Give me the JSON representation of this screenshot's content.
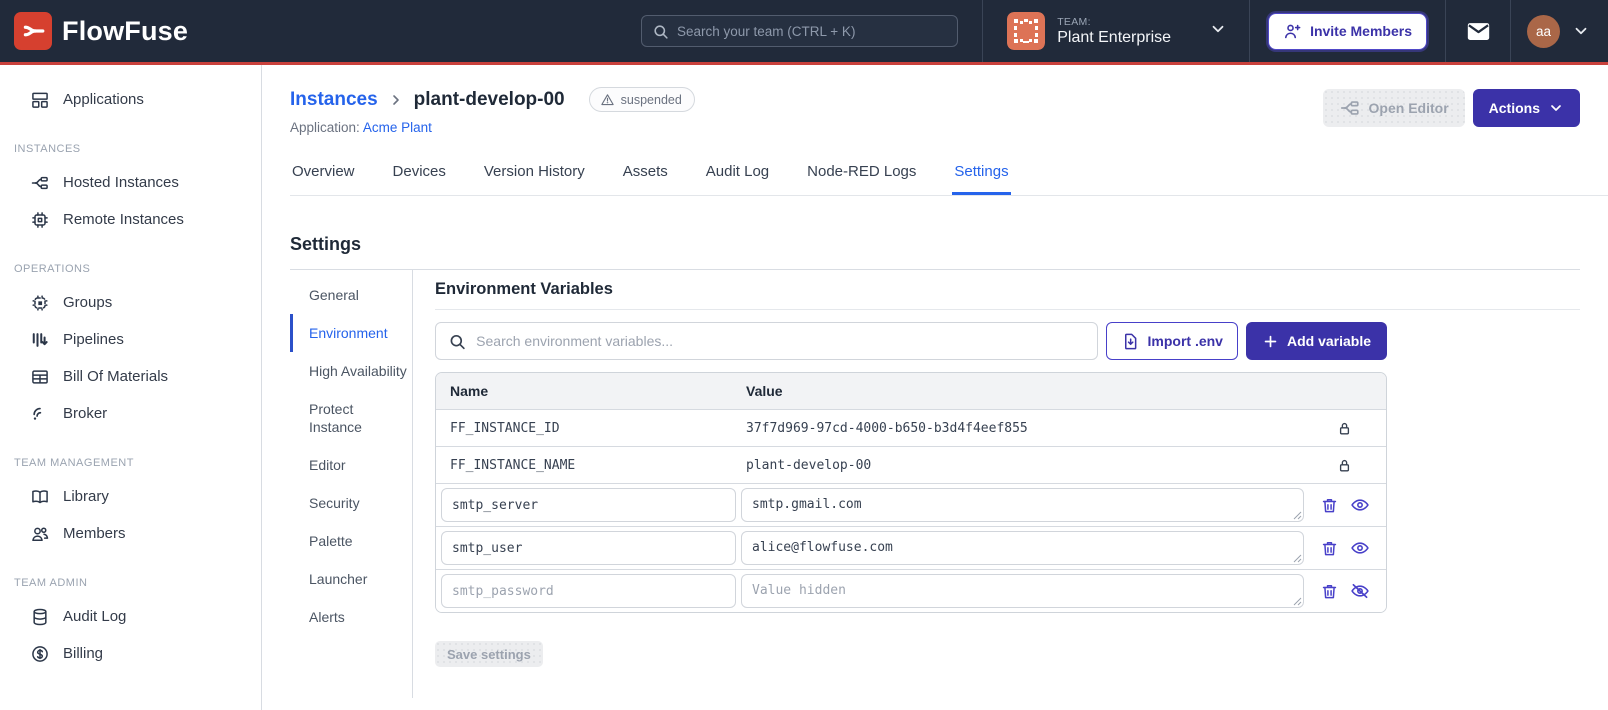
{
  "navbar": {
    "brand": "FlowFuse",
    "search": {
      "placeholder": "Search your team (CTRL + K)"
    },
    "team": {
      "label": "TEAM:",
      "name": "Plant Enterprise"
    },
    "invite_button": "Invite Members",
    "user": {
      "initials": "aa"
    }
  },
  "sidebar": {
    "applications": "Applications",
    "sections": [
      {
        "heading": "INSTANCES",
        "items": [
          "Hosted Instances",
          "Remote Instances"
        ]
      },
      {
        "heading": "OPERATIONS",
        "items": [
          "Groups",
          "Pipelines",
          "Bill Of Materials",
          "Broker"
        ]
      },
      {
        "heading": "TEAM MANAGEMENT",
        "items": [
          "Library",
          "Members"
        ]
      },
      {
        "heading": "TEAM ADMIN",
        "items": [
          "Audit Log",
          "Billing"
        ]
      }
    ]
  },
  "header": {
    "breadcrumb": {
      "parent": "Instances",
      "current": "plant-develop-00"
    },
    "status_badge": "suspended",
    "application_label": "Application:",
    "application_name": "Acme Plant",
    "open_editor_button": "Open Editor",
    "actions_button": "Actions"
  },
  "tabs": [
    "Overview",
    "Devices",
    "Version History",
    "Assets",
    "Audit Log",
    "Node-RED Logs",
    "Settings"
  ],
  "active_tab": "Settings",
  "settings": {
    "title": "Settings",
    "nav": [
      "General",
      "Environment",
      "High Availability",
      "Protect Instance",
      "Editor",
      "Security",
      "Palette",
      "Launcher",
      "Alerts"
    ],
    "active_nav": "Environment",
    "panel": {
      "title": "Environment Variables",
      "search_placeholder": "Search environment variables...",
      "import_button": "Import .env",
      "add_button": "Add variable",
      "table": {
        "columns": [
          "Name",
          "Value"
        ],
        "locked_rows": [
          {
            "name": "FF_INSTANCE_ID",
            "value": "37f7d969-97cd-4000-b650-b3d4f4eef855"
          },
          {
            "name": "FF_INSTANCE_NAME",
            "value": "plant-develop-00"
          }
        ],
        "editable_rows": [
          {
            "name": "smtp_server",
            "value": "smtp.gmail.com",
            "hidden": false
          },
          {
            "name": "smtp_user",
            "value": "alice@flowfuse.com",
            "hidden": false
          },
          {
            "name": "smtp_password",
            "value": "",
            "value_placeholder": "Value hidden",
            "hidden": true
          }
        ]
      },
      "save_button": "Save settings"
    }
  },
  "colors": {
    "navbar_bg": "#212A3A",
    "brand_red": "#D6402F",
    "accent_indigo": "#3B32A8",
    "icon_indigo": "#4840C9",
    "link_blue": "#2563EB",
    "disabled_text": "#9CA3AF",
    "user_avatar_bg": "#AA6748",
    "team_avatar_bg": "#DD7356"
  }
}
